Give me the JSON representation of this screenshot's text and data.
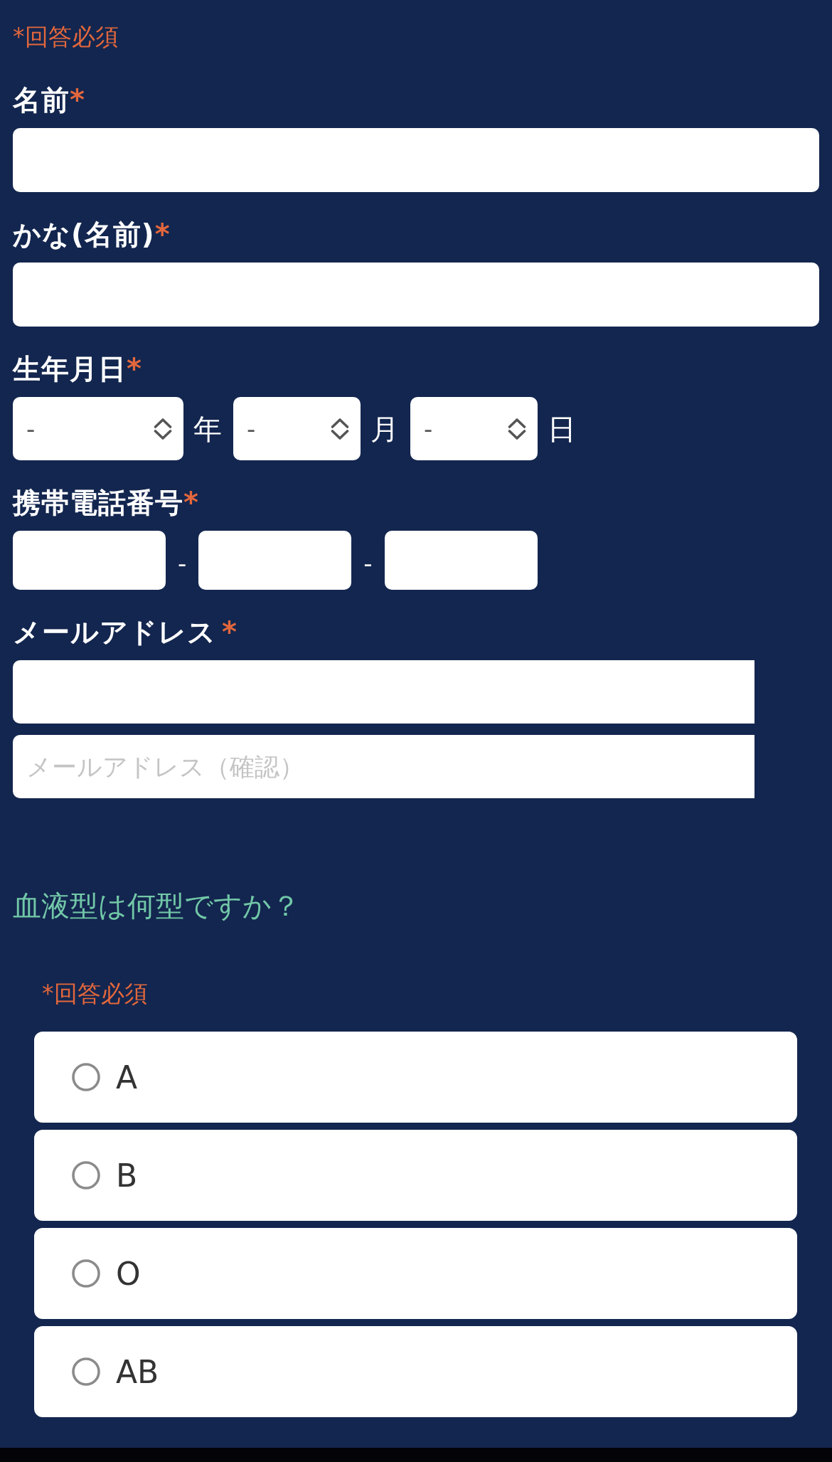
{
  "required_note": "*回答必須",
  "fields": [
    {
      "kind": "text",
      "label": "名前",
      "required_mark": "*"
    },
    {
      "kind": "text",
      "label": "かな(名前)",
      "required_mark": "*"
    },
    {
      "kind": "date",
      "label": "生年月日",
      "required_mark": "*",
      "selects": [
        {
          "value": "-",
          "unit": "年"
        },
        {
          "value": "-",
          "unit": "月"
        },
        {
          "value": "-",
          "unit": "日"
        }
      ]
    },
    {
      "kind": "phone",
      "label": "携帯電話番号",
      "required_mark": "*",
      "parts": [
        {
          "kind": "input"
        },
        {
          "kind": "separator",
          "text": "-"
        },
        {
          "kind": "input"
        },
        {
          "kind": "separator",
          "text": "-"
        },
        {
          "kind": "input"
        }
      ]
    },
    {
      "kind": "email",
      "label": "メールアドレス",
      "required_mark": "*",
      "inputs": [
        {
          "kind": "input"
        },
        {
          "kind": "input",
          "placeholder": "メールアドレス（確認）"
        }
      ]
    }
  ],
  "question": {
    "text": "血液型は何型ですか？",
    "required_note": "*回答必須",
    "options": [
      {
        "label": "A",
        "selected": false
      },
      {
        "label": "B",
        "selected": false
      },
      {
        "label": "O",
        "selected": false
      },
      {
        "label": "AB",
        "selected": false
      }
    ]
  }
}
